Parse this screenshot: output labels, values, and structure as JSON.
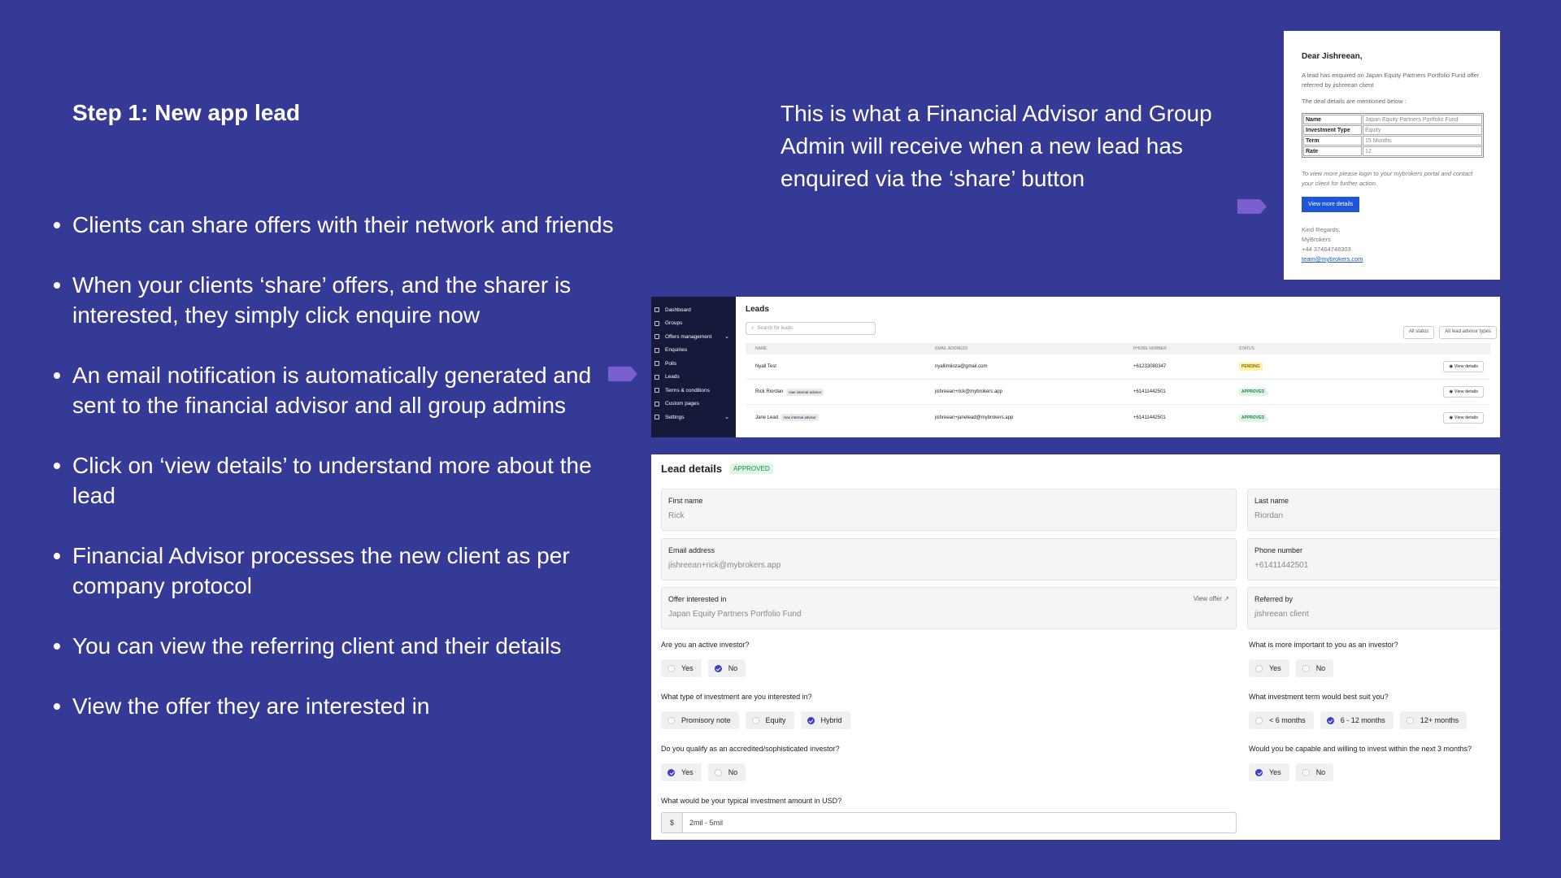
{
  "slide": {
    "step_title": "Step 1:  New app lead",
    "bullets": [
      "Clients can share offers with their network and friends",
      "When your clients ‘share’ offers, and the sharer is interested, they simply click enquire now",
      "An email notification is automatically generated and sent to the financial advisor and all group admins",
      "Click on ‘view details’ to understand more about the lead",
      "Financial Advisor processes the new client as per company protocol",
      "You can view the referring client and their details",
      "View the offer they are interested in"
    ],
    "info_text": "This is what a Financial Advisor and Group Admin will receive when a new lead has enquired via the ‘share’ button",
    "arrow_color": "#7b5fd0",
    "background": "#353a96"
  },
  "email": {
    "greeting": "Dear Jishreean,",
    "intro": "A lead has enquired on Japan Equity Partners Portfolio Fund offer referred by jishreean client",
    "details_intro": "The deal details are mentioned below :",
    "rows": [
      {
        "k": "Name",
        "v": "Japan Equity Partners Portfolio Fund"
      },
      {
        "k": "Investment Type",
        "v": "Equity"
      },
      {
        "k": "Term",
        "v": "15 Months"
      },
      {
        "k": "Rate",
        "v": "12"
      }
    ],
    "note": "To view more please login to your mybrokers portal and contact your client for further action.",
    "button": "View more details",
    "sign1": "Kind Regards,",
    "sign2": "MyBrokers",
    "sign3": "+44 37464748303",
    "sign4": "team@mybrokers.com"
  },
  "leads": {
    "sidebar": [
      "Dashboard",
      "Groups",
      "Offers management",
      "Enquiries",
      "Polls",
      "Leads",
      "Terms & conditions",
      "Custom pages",
      "Settings"
    ],
    "title": "Leads",
    "search_placeholder": "Search for leads",
    "filter1": "All status",
    "filter2": "All lead advisor types",
    "columns": [
      "NAME",
      "EMAIL ADDRESS",
      "PHONE NUMBER",
      "STATUS"
    ],
    "rows": [
      {
        "name": "Nyall Test",
        "tag": "",
        "email": "nyallimlioza@gmail.com",
        "phone": "+61233080347",
        "status": "PENDING",
        "action": "View details"
      },
      {
        "name": "Rick Riordan",
        "tag": "Has internal advisor",
        "email": "jishreean+rick@mybrokers.app",
        "phone": "+61411442501",
        "status": "APPROVED",
        "action": "View details"
      },
      {
        "name": "Jane Lead",
        "tag": "Has internal advisor",
        "email": "jishreean+janelead@mybrokers.app",
        "phone": "+61411442501",
        "status": "APPROVED",
        "action": "View details"
      }
    ]
  },
  "details": {
    "title": "Lead details",
    "badge": "APPROVED",
    "first_name_label": "First name",
    "first_name": "Rick",
    "last_name_label": "Last name",
    "last_name": "Riordan",
    "email_label": "Email address",
    "email": "jishreean+rick@mybrokers.app",
    "phone_label": "Phone number",
    "phone": "+61411442501",
    "offer_label": "Offer interested in",
    "offer": "Japan Equity Partners Portfolio Fund",
    "view_offer": "View offer",
    "referred_label": "Referred by",
    "referred": "jishreean client",
    "q1": "Are you an active investor?",
    "q1_opts": [
      "Yes",
      "No"
    ],
    "q1_sel": "No",
    "q2": "What is more important to you as an investor?",
    "q2_opts": [
      "Yes",
      "No"
    ],
    "q2_sel": "",
    "q3": "What type of investment are you interested in?",
    "q3_opts": [
      "Promisory note",
      "Equity",
      "Hybrid"
    ],
    "q3_sel": "Hybrid",
    "q4": "What investment term would best suit you?",
    "q4_opts": [
      "< 6 months",
      "6 - 12 months",
      "12+ months"
    ],
    "q4_sel": "6 - 12 months",
    "q5": "Do you qualify as an accredited/sophisticated investor?",
    "q5_opts": [
      "Yes",
      "No"
    ],
    "q5_sel": "Yes",
    "q6": "Would you be capable and willing to invest within the next 3 months?",
    "q6_opts": [
      "Yes",
      "No"
    ],
    "q6_sel": "Yes",
    "q7": "What would be your typical investment amount in USD?",
    "currency": "$",
    "amount": "2mil - 5mil"
  }
}
